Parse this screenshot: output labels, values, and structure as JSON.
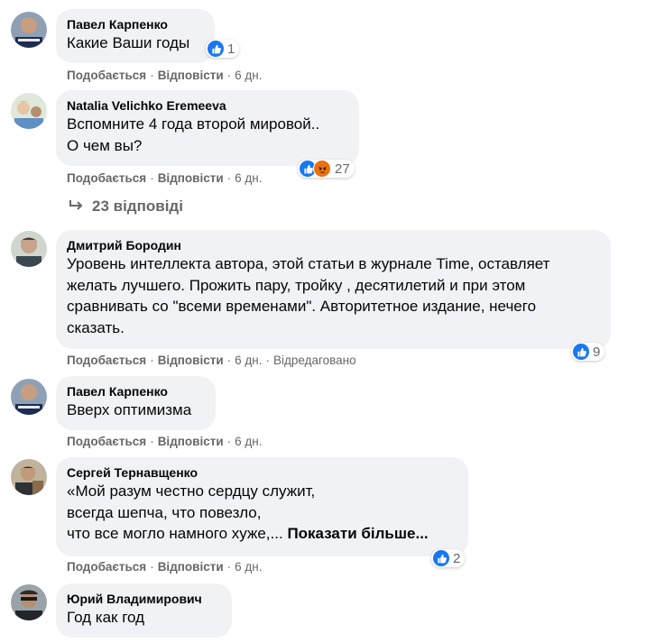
{
  "comments": [
    {
      "author": "Павел Карпенко",
      "lines": [
        "Какие Ваши годы"
      ],
      "reaction_count": "1",
      "actions": {
        "like": "Подобається",
        "reply": "Відповісти",
        "time": "6 дн."
      }
    },
    {
      "author": "Natalia Velichko Eremeeva",
      "lines": [
        "Вспомните 4 года второй мировой..",
        "О чем вы?"
      ],
      "reaction_count": "27",
      "actions": {
        "like": "Подобається",
        "reply": "Відповісти",
        "time": "6 дн."
      },
      "replies_label": "23 відповіді"
    },
    {
      "author": "Дмитрий Бородин",
      "lines": [
        "Уровень интеллекта автора, этой статьи в журнале Time, оставляет",
        "желать лучшего. Прожить пару, тройку , десятилетий и при этом",
        "сравнивать со \"всеми временами\". Авторитетное издание, нечего",
        "сказать."
      ],
      "reaction_count": "9",
      "actions": {
        "like": "Подобається",
        "reply": "Відповісти",
        "time": "6 дн.",
        "edited": "Відредаговано"
      }
    },
    {
      "author": "Павел Карпенко",
      "lines": [
        "Вверх оптимизма"
      ],
      "actions": {
        "like": "Подобається",
        "reply": "Відповісти",
        "time": "6 дн."
      }
    },
    {
      "author": "Сергей Тернавщенко",
      "lines": [
        "«Мой разум честно сердцу служит,",
        "всегда шепча, что повезло,",
        "что все могло намного хуже,..."
      ],
      "see_more": "Показати більше...",
      "reaction_count": "2",
      "actions": {
        "like": "Подобається",
        "reply": "Відповісти",
        "time": "6 дн."
      }
    },
    {
      "author": "Юрий Владимирович",
      "lines": [
        "Год как год"
      ]
    }
  ],
  "colors": {
    "bubble": "#f0f2f5",
    "like_blue": "#1877f2",
    "angry_orange": "#e9710f",
    "meta_gray": "#65676b"
  }
}
